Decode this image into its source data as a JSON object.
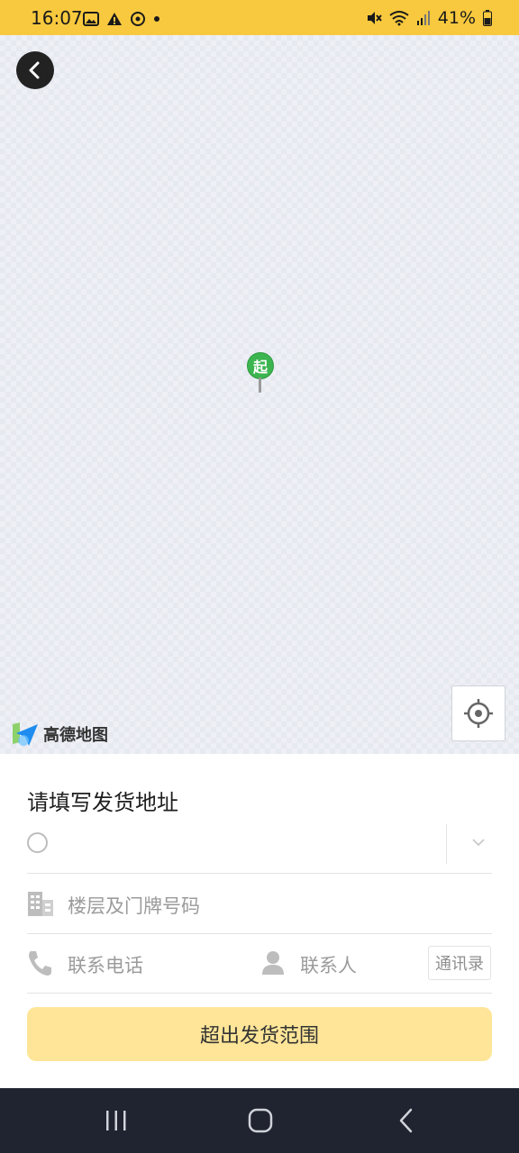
{
  "status_bar": {
    "time": "16:07",
    "battery": "41%",
    "left_icons": [
      "gallery-icon",
      "warning-icon",
      "sync-icon",
      "dot-icon"
    ],
    "right_icons": [
      "mute-icon",
      "wifi-icon",
      "signal-icon",
      "battery-icon"
    ]
  },
  "map": {
    "pin_label": "起",
    "logo_text": "高德地图",
    "colors": {
      "pin": "#3cb550",
      "background": "#eef0f5"
    }
  },
  "form": {
    "title": "请填写发货地址",
    "address_value": "",
    "floor_placeholder": "楼层及门牌号码",
    "phone_placeholder": "联系电话",
    "contact_placeholder": "联系人",
    "contacts_button": "通讯录",
    "submit_label": "超出发货范围",
    "colors": {
      "accent": "#f8c93e",
      "submit_bg": "#fee598"
    }
  },
  "nav": {
    "icons": [
      "recent-apps-icon",
      "home-icon",
      "back-nav-icon"
    ]
  }
}
